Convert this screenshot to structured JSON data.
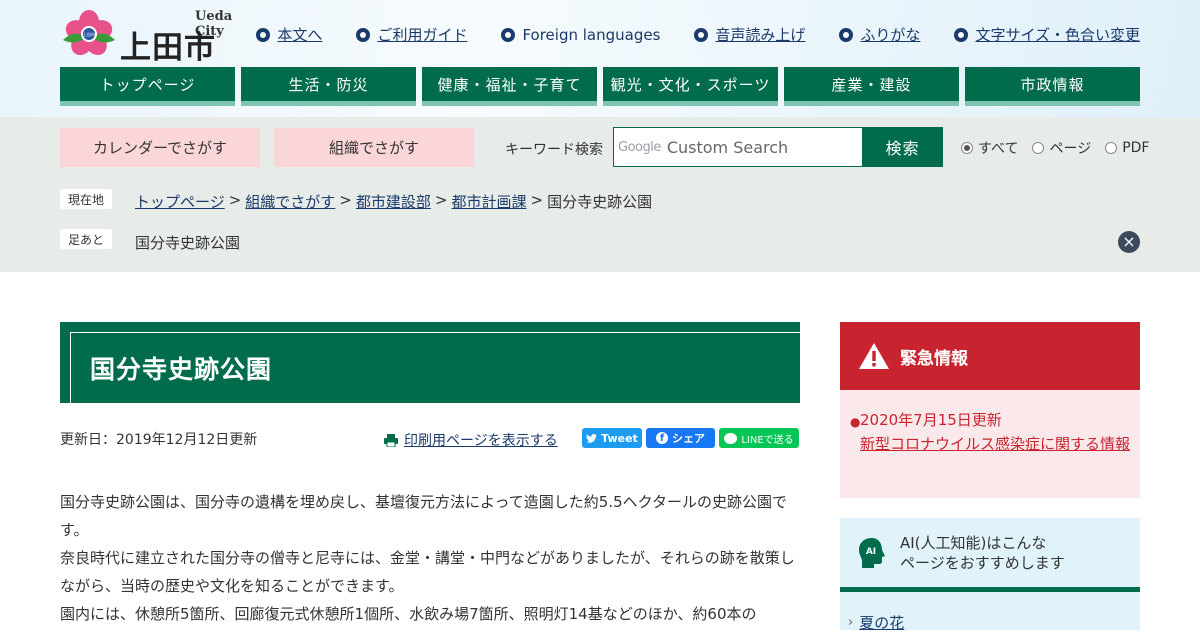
{
  "header": {
    "logo_en": "Ueda City",
    "logo_jp": "上田市",
    "logo_seal_text": "上田市",
    "util_links": [
      {
        "label": "本文へ"
      },
      {
        "label": "ご利用ガイド"
      },
      {
        "label": "Foreign languages"
      },
      {
        "label": "音声読み上げ"
      },
      {
        "label": "ふりがな"
      },
      {
        "label": "文字サイズ・色合い変更"
      }
    ]
  },
  "gnav": [
    "トップページ",
    "生活・防災",
    "健康・福祉・子育て",
    "観光・文化・スポーツ",
    "産業・建設",
    "市政情報"
  ],
  "search": {
    "calendar_label": "カレンダーでさがす",
    "org_label": "組織でさがす",
    "keyword_label": "キーワード検索",
    "google_label": "Google",
    "placeholder": "Custom Search",
    "button_label": "検索",
    "options": [
      {
        "label": "すべて",
        "selected": true
      },
      {
        "label": "ページ",
        "selected": false
      },
      {
        "label": "PDF",
        "selected": false
      }
    ]
  },
  "location": {
    "current_tag": "現在地",
    "footprint_tag": "足あと",
    "crumbs": [
      "トップページ",
      "組織でさがす",
      "都市建設部",
      "都市計画課"
    ],
    "separator": ">",
    "current": "国分寺史跡公園",
    "footprint": "国分寺史跡公園"
  },
  "article": {
    "title": "国分寺史跡公園",
    "updated": "更新日：2019年12月12日更新",
    "print_label": "印刷用ページを表示する",
    "tweet_label": "Tweet",
    "share_label": "シェア",
    "line_label": "LINEで送る",
    "paragraphs": [
      "国分寺史跡公園は、国分寺の遺構を埋め戻し、基壇復元方法によって造園した約5.5ヘクタールの史跡公園です。",
      "奈良時代に建立された国分寺の僧寺と尼寺には、金堂・講堂・中門などがありましたが、それらの跡を散策しながら、当時の歴史や文化を知ることができます。",
      "園内には、休憩所5箇所、回廊復元式休憩所1個所、水飲み場7箇所、照明灯14基などのほか、約60本の"
    ]
  },
  "sidebar": {
    "emergency_title": "緊急情報",
    "emergency_date": "2020年7月15日更新",
    "emergency_link": "新型コロナウイルス感染症に関する情報",
    "ai_badge": "AI",
    "ai_title_line1": "AI(人工知能)はこんな",
    "ai_title_line2": "ページをおすすめします",
    "ai_item": "夏の花"
  },
  "colors": {
    "brand_green": "#006c4c",
    "emergency_red": "#c8242f",
    "link_navy": "#1a3a6b"
  }
}
